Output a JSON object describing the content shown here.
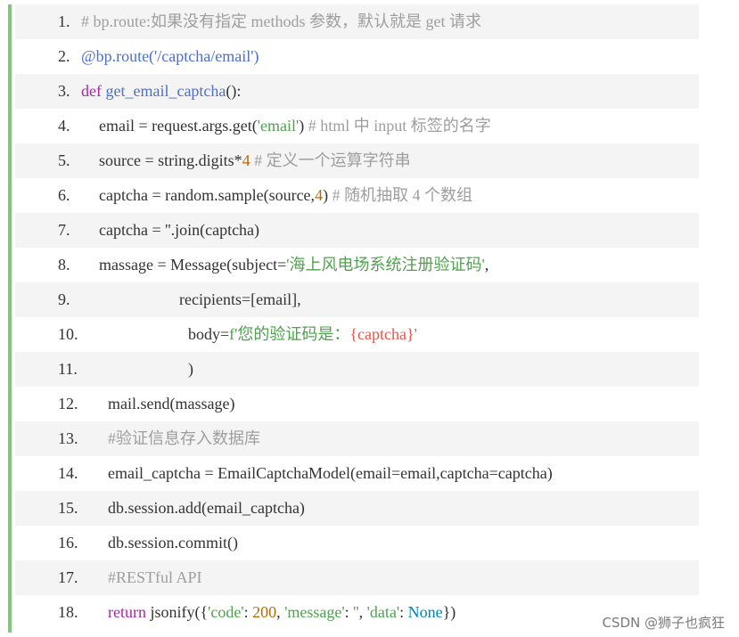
{
  "lines": [
    {
      "num": "1.",
      "parts": [
        {
          "t": "# bp.route:如果没有指定 methods 参数，默认就是 get 请求",
          "c": "comment"
        }
      ]
    },
    {
      "num": "2.",
      "parts": [
        {
          "t": "@bp.route('/captcha/email')",
          "c": "deco"
        }
      ]
    },
    {
      "num": "3.",
      "parts": [
        {
          "t": "def ",
          "c": "kw"
        },
        {
          "t": "get_email_captcha",
          "c": "def"
        },
        {
          "t": "():",
          "c": "plain"
        }
      ]
    },
    {
      "num": "4.",
      "parts": [
        {
          "t": "email = request.args.get(",
          "c": "plain"
        },
        {
          "t": "'email'",
          "c": "str"
        },
        {
          "t": ") ",
          "c": "plain"
        },
        {
          "t": "# html 中 input 标签的名字",
          "c": "comment"
        }
      ]
    },
    {
      "num": "5.",
      "parts": [
        {
          "t": "source = string.digits*",
          "c": "plain"
        },
        {
          "t": "4",
          "c": "num"
        },
        {
          "t": " # 定义一个运算字符串",
          "c": "comment"
        }
      ]
    },
    {
      "num": "6.",
      "parts": [
        {
          "t": "captcha = random.sample(source,",
          "c": "plain"
        },
        {
          "t": "4",
          "c": "num"
        },
        {
          "t": ") ",
          "c": "plain"
        },
        {
          "t": "# 随机抽取 4 个数组",
          "c": "comment"
        }
      ]
    },
    {
      "num": "7.",
      "parts": [
        {
          "t": "captcha = ''.join(captcha)",
          "c": "plain"
        }
      ]
    },
    {
      "num": "8.",
      "parts": [
        {
          "t": "massage = Message(subject=",
          "c": "plain"
        },
        {
          "t": "'海上风电场系统注册验证码'",
          "c": "str"
        },
        {
          "t": ",",
          "c": "plain"
        }
      ]
    },
    {
      "num": "9.",
      "parts": [
        {
          "t": "recipients=[email],",
          "c": "plain"
        }
      ]
    },
    {
      "num": "10.",
      "parts": [
        {
          "t": "body=",
          "c": "plain"
        },
        {
          "t": "f'您的验证码是：",
          "c": "str"
        },
        {
          "t": "{captcha}",
          "c": "red"
        },
        {
          "t": "'",
          "c": "str"
        }
      ]
    },
    {
      "num": "11.",
      "parts": [
        {
          "t": ")",
          "c": "plain"
        }
      ]
    },
    {
      "num": "12.",
      "parts": [
        {
          "t": "mail.send(massage)",
          "c": "plain"
        }
      ]
    },
    {
      "num": "13.",
      "parts": [
        {
          "t": "#验证信息存入数据库",
          "c": "comment"
        }
      ]
    },
    {
      "num": "14.",
      "parts": [
        {
          "t": "email_captcha = EmailCaptchaModel(email=email,captcha=captcha)",
          "c": "plain"
        }
      ]
    },
    {
      "num": "15.",
      "parts": [
        {
          "t": "db.session.add(email_captcha)",
          "c": "plain"
        }
      ]
    },
    {
      "num": "16.",
      "parts": [
        {
          "t": "db.session.commit()",
          "c": "plain"
        }
      ]
    },
    {
      "num": "17.",
      "parts": [
        {
          "t": "#RESTful API",
          "c": "comment"
        }
      ]
    },
    {
      "num": "18.",
      "parts": [
        {
          "t": "return ",
          "c": "kw"
        },
        {
          "t": "jsonify({",
          "c": "plain"
        },
        {
          "t": "'code'",
          "c": "str"
        },
        {
          "t": ": ",
          "c": "plain"
        },
        {
          "t": "200",
          "c": "num"
        },
        {
          "t": ", ",
          "c": "plain"
        },
        {
          "t": "'message'",
          "c": "str"
        },
        {
          "t": ": ",
          "c": "plain"
        },
        {
          "t": "''",
          "c": "str"
        },
        {
          "t": ", ",
          "c": "plain"
        },
        {
          "t": "'data'",
          "c": "str"
        },
        {
          "t": ": ",
          "c": "plain"
        },
        {
          "t": "None",
          "c": "none"
        },
        {
          "t": "})",
          "c": "plain"
        }
      ]
    }
  ],
  "watermark": "CSDN @狮子也疯狂",
  "colors": {
    "accent_border": "#7ec87c",
    "comment": "#9e9e9e",
    "string": "#50a14f",
    "keyword": "#a626a4",
    "decorator": "#4e6fce",
    "number": "#b76b01",
    "interp": "#e45649",
    "none": "#0184bc"
  }
}
